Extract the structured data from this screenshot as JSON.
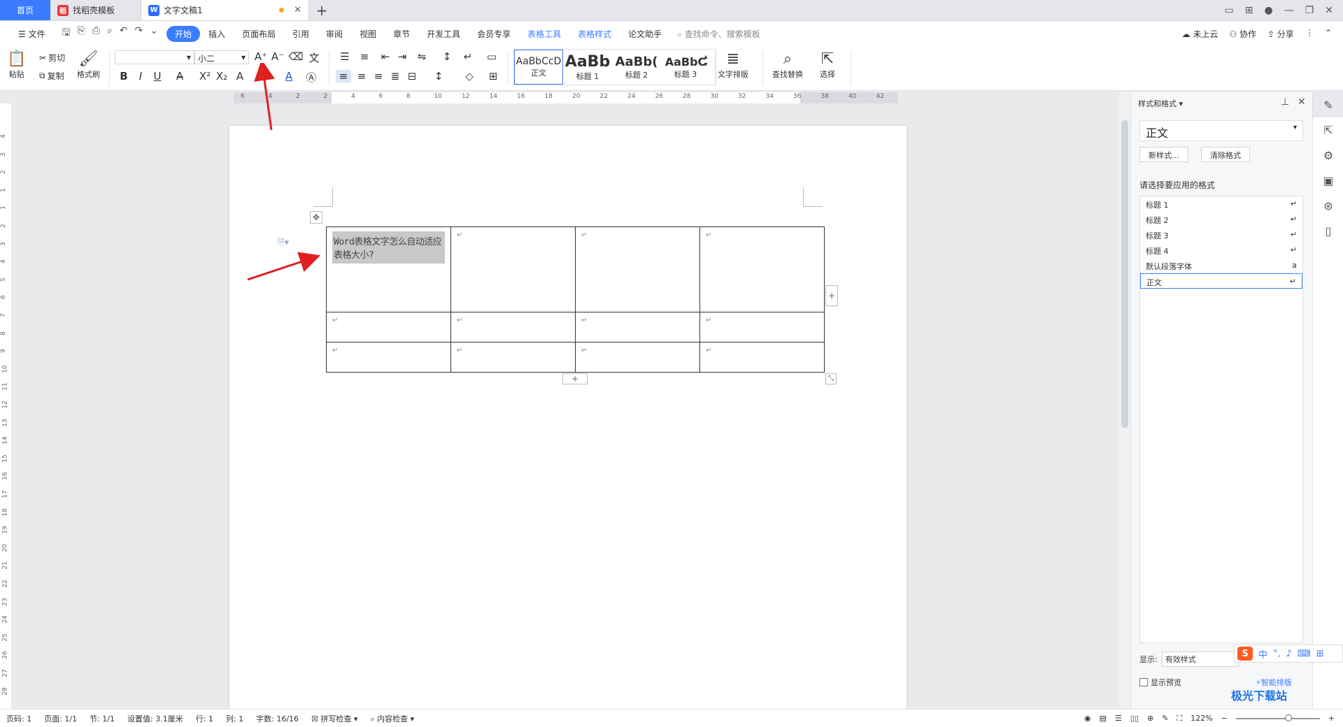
{
  "tabs": {
    "home": "首页",
    "template": "找稻壳模板",
    "doc": "文字文稿1"
  },
  "menu": {
    "file": "文件",
    "items": [
      "开始",
      "插入",
      "页面布局",
      "引用",
      "审阅",
      "视图",
      "章节",
      "开发工具",
      "会员专享"
    ],
    "table_tools": "表格工具",
    "table_style": "表格样式",
    "paper": "论文助手",
    "search": "查找命令、搜索模板",
    "cloud": "未上云",
    "collab": "协作",
    "share": "分享"
  },
  "ribbon": {
    "paste": "粘贴",
    "cut": "剪切",
    "copy": "复制",
    "format_painter": "格式刷",
    "font_name": "",
    "font_size": "小二",
    "styles": [
      {
        "preview": "AaBbCcD",
        "label": "正文"
      },
      {
        "preview": "AaBb",
        "label": "标题 1"
      },
      {
        "preview": "AaBb(",
        "label": "标题 2"
      },
      {
        "preview": "AaBbC",
        "label": "标题 3"
      }
    ],
    "text_layout": "文字排版",
    "find_replace": "查找替换",
    "select": "选择"
  },
  "ruler": {
    "h": [
      "6",
      "4",
      "2",
      "2",
      "4",
      "6",
      "8",
      "10",
      "12",
      "14",
      "16",
      "18",
      "20",
      "22",
      "24",
      "26",
      "28",
      "30",
      "32",
      "34",
      "36",
      "38",
      "40",
      "42"
    ],
    "v": [
      "4",
      "3",
      "2",
      "1",
      "1",
      "2",
      "3",
      "4",
      "5",
      "6",
      "7",
      "8",
      "9",
      "10",
      "11",
      "12",
      "13",
      "14",
      "15",
      "16",
      "17",
      "18",
      "19",
      "20",
      "21",
      "22",
      "23",
      "24",
      "25",
      "26",
      "27",
      "28"
    ]
  },
  "document": {
    "cell_text": "Word表格文字怎么自动适应表格大小?"
  },
  "pane": {
    "title": "样式和格式",
    "current": "正文",
    "new_style": "新样式...",
    "clear_format": "清除格式",
    "prompt": "请选择要应用的格式",
    "styles": [
      "标题 1",
      "标题 2",
      "标题 3",
      "标题 4",
      "默认段落字体",
      "正文"
    ],
    "show_label": "显示:",
    "show_value": "有效样式",
    "preview": "显示预览",
    "smart": "智能排版"
  },
  "ime": {
    "mode": "中"
  },
  "status": {
    "page": "页码: 1",
    "pages": "页面: 1/1",
    "section": "节: 1/1",
    "setting": "设置值: 3.1厘米",
    "row": "行: 1",
    "col": "列: 1",
    "words": "字数: 16/16",
    "spell": "拼写检查",
    "content": "内容检查",
    "zoom": "122%"
  },
  "watermark": "极光下载站"
}
